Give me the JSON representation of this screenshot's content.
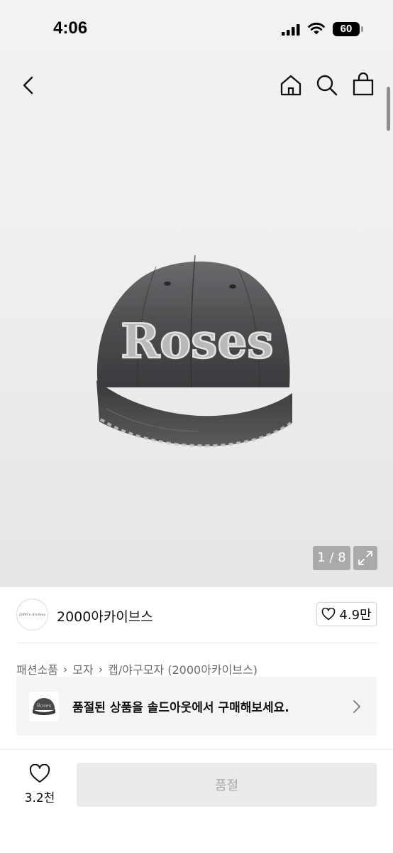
{
  "status_bar": {
    "time": "4:06",
    "battery": "60"
  },
  "nav": {
    "back_icon": "chevron-left-icon",
    "home_icon": "home-icon",
    "search_icon": "search-icon",
    "bag_icon": "shopping-bag-icon"
  },
  "product": {
    "image_text": "Roses",
    "image_index": "1 / 8"
  },
  "store": {
    "logo_text": "2000's Archive",
    "name": "2000아카이브스",
    "likes": "4.9만"
  },
  "breadcrumb": [
    "패션소품",
    "모자",
    "캡/야구모자 (2000아카이브스)"
  ],
  "banner": {
    "text": "품절된 상품을 솔드아웃에서 구매해보세요."
  },
  "bottom_bar": {
    "wish_count": "3.2천",
    "button_label": "품절"
  },
  "colors": {
    "cap": "#4a4a4c",
    "button_bg": "#ebebeb",
    "button_text": "#a8a8a8"
  }
}
